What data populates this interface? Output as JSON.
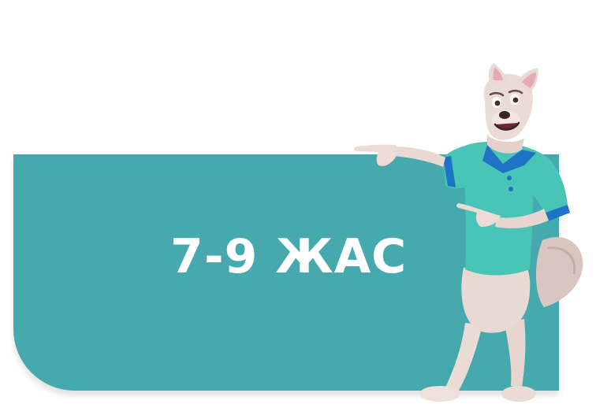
{
  "banner": {
    "title": "7-9 ЖАС"
  },
  "colors": {
    "banner_fill": "#45a9ad",
    "shirt": "#48c5b7",
    "shirt_trim": "#1e73c4",
    "fur": "#e9d9d3"
  },
  "mascot": {
    "icon": "pointing-dog-mascot"
  }
}
